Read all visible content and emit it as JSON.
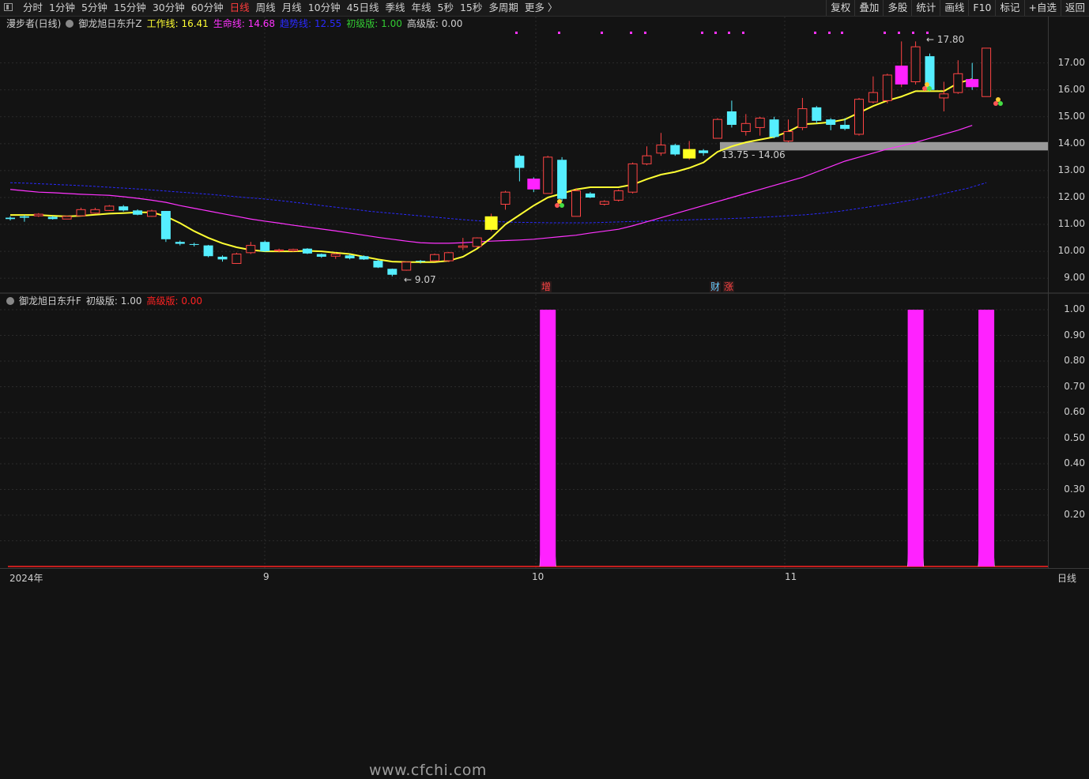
{
  "toolbar": {
    "periods": [
      "分时",
      "1分钟",
      "5分钟",
      "15分钟",
      "30分钟",
      "60分钟",
      "日线",
      "周线",
      "月线",
      "10分钟",
      "45日线",
      "季线",
      "年线",
      "5秒",
      "15秒",
      "多周期",
      "更多 〉"
    ],
    "active_period": "日线",
    "tools": [
      "复权",
      "叠加",
      "多股",
      "统计",
      "画线",
      "F10",
      "标记",
      "+自选",
      "返回"
    ]
  },
  "main": {
    "stock": "漫步者(日线)",
    "indicator": "御龙旭日东升Z",
    "legend": [
      {
        "label": "工作线: 16.41",
        "color": "#ffff33"
      },
      {
        "label": "生命线: 14.68",
        "color": "#ff33ff"
      },
      {
        "label": "趋势线: 12.55",
        "color": "#2a2aff"
      },
      {
        "label": "初级版: 1.00",
        "color": "#33cc33"
      },
      {
        "label": "高级版: 0.00",
        "color": "#d0d0d0"
      }
    ],
    "y_ticks": [
      "17.00",
      "16.00",
      "15.00",
      "14.00",
      "13.00",
      "12.00",
      "11.00",
      "10.00",
      "9.00"
    ],
    "high_label": "17.80",
    "low_label": "9.07",
    "range_label": "13.75 - 14.06",
    "markers": [
      {
        "text": "增",
        "color": "#ff4444"
      },
      {
        "text": "财",
        "color": "#66ccff"
      },
      {
        "text": "涨",
        "color": "#ff4444"
      }
    ]
  },
  "sub": {
    "indicator": "御龙旭日东升F",
    "legend": [
      {
        "label": "初级版: 1.00",
        "color": "#d0d0d0"
      },
      {
        "label": "高级版: 0.00",
        "color": "#ff2222"
      }
    ],
    "y_ticks": [
      "1.00",
      "0.90",
      "0.80",
      "0.70",
      "0.60",
      "0.50",
      "0.40",
      "0.30",
      "0.20"
    ],
    "watermark": "www.cfchi.com"
  },
  "x_axis": {
    "labels": [
      "2024年",
      "9",
      "10",
      "11"
    ],
    "period_label": "日线"
  },
  "colors": {
    "up": "#ff4444",
    "down": "#55eeff",
    "work_line": "#ffff33",
    "life_line": "#ff33ff",
    "trend_line": "#2a2aff",
    "signal_bar": "#ff22ff"
  },
  "chart_data": {
    "type": "candlestick",
    "y_range": [
      8.8,
      17.9
    ],
    "candles": [
      {
        "o": 11.25,
        "c": 11.2,
        "h": 11.3,
        "l": 11.15
      },
      {
        "o": 11.3,
        "c": 11.25,
        "h": 11.35,
        "l": 11.1
      },
      {
        "o": 11.32,
        "c": 11.38,
        "h": 11.42,
        "l": 11.28
      },
      {
        "o": 11.28,
        "c": 11.2,
        "h": 11.32,
        "l": 11.18
      },
      {
        "o": 11.2,
        "c": 11.3,
        "h": 11.33,
        "l": 11.2
      },
      {
        "o": 11.32,
        "c": 11.55,
        "h": 11.62,
        "l": 11.3
      },
      {
        "o": 11.42,
        "c": 11.55,
        "h": 11.62,
        "l": 11.4
      },
      {
        "o": 11.52,
        "c": 11.68,
        "h": 11.72,
        "l": 11.5
      },
      {
        "o": 11.67,
        "c": 11.52,
        "h": 11.72,
        "l": 11.48
      },
      {
        "o": 11.52,
        "c": 11.36,
        "h": 11.56,
        "l": 11.34
      },
      {
        "o": 11.3,
        "c": 11.5,
        "h": 11.55,
        "l": 11.28
      },
      {
        "o": 11.5,
        "c": 10.45,
        "h": 11.5,
        "l": 10.35
      },
      {
        "o": 10.35,
        "c": 10.28,
        "h": 10.4,
        "l": 10.22
      },
      {
        "o": 10.27,
        "c": 10.25,
        "h": 10.32,
        "l": 10.18
      },
      {
        "o": 10.22,
        "c": 9.82,
        "h": 10.24,
        "l": 9.78
      },
      {
        "o": 9.8,
        "c": 9.7,
        "h": 9.85,
        "l": 9.62
      },
      {
        "o": 9.55,
        "c": 9.9,
        "h": 9.95,
        "l": 9.55
      },
      {
        "o": 9.95,
        "c": 10.22,
        "h": 10.35,
        "l": 9.9
      },
      {
        "o": 10.35,
        "c": 10.0,
        "h": 10.4,
        "l": 9.98
      },
      {
        "o": 10.02,
        "c": 10.05,
        "h": 10.1,
        "l": 9.96
      },
      {
        "o": 10.02,
        "c": 10.07,
        "h": 10.1,
        "l": 9.98
      },
      {
        "o": 10.1,
        "c": 9.92,
        "h": 10.12,
        "l": 9.9
      },
      {
        "o": 9.9,
        "c": 9.8,
        "h": 9.92,
        "l": 9.76
      },
      {
        "o": 9.82,
        "c": 9.9,
        "h": 9.95,
        "l": 9.72
      },
      {
        "o": 9.85,
        "c": 9.74,
        "h": 9.9,
        "l": 9.7
      },
      {
        "o": 9.82,
        "c": 9.7,
        "h": 9.85,
        "l": 9.68
      },
      {
        "o": 9.65,
        "c": 9.4,
        "h": 9.68,
        "l": 9.38
      },
      {
        "o": 9.35,
        "c": 9.13,
        "h": 9.36,
        "l": 9.07
      },
      {
        "o": 9.3,
        "c": 9.6,
        "h": 9.62,
        "l": 9.28
      },
      {
        "o": 9.65,
        "c": 9.62,
        "h": 9.68,
        "l": 9.55
      },
      {
        "o": 9.65,
        "c": 9.88,
        "h": 9.92,
        "l": 9.62
      },
      {
        "o": 9.65,
        "c": 9.95,
        "h": 9.98,
        "l": 9.6
      },
      {
        "o": 10.15,
        "c": 10.2,
        "h": 10.5,
        "l": 10.05
      },
      {
        "o": 10.18,
        "c": 10.5,
        "h": 10.52,
        "l": 10.15
      },
      {
        "o": 10.8,
        "c": 11.3,
        "h": 11.4,
        "l": 10.75
      },
      {
        "o": 11.75,
        "c": 12.2,
        "h": 12.25,
        "l": 11.55
      },
      {
        "o": 13.55,
        "c": 13.1,
        "h": 13.6,
        "l": 12.6
      },
      {
        "o": 12.7,
        "c": 12.3,
        "h": 12.75,
        "l": 12.2
      },
      {
        "o": 12.15,
        "c": 13.5,
        "h": 13.55,
        "l": 12.15
      },
      {
        "o": 13.4,
        "c": 11.95,
        "h": 13.5,
        "l": 11.85
      },
      {
        "o": 11.3,
        "c": 12.25,
        "h": 12.35,
        "l": 11.3
      },
      {
        "o": 12.15,
        "c": 12.0,
        "h": 12.2,
        "l": 11.98
      },
      {
        "o": 11.75,
        "c": 11.85,
        "h": 11.9,
        "l": 11.7
      },
      {
        "o": 11.9,
        "c": 12.25,
        "h": 12.3,
        "l": 11.85
      },
      {
        "o": 12.2,
        "c": 13.25,
        "h": 13.3,
        "l": 12.15
      },
      {
        "o": 13.25,
        "c": 13.55,
        "h": 13.9,
        "l": 13.2
      },
      {
        "o": 13.65,
        "c": 13.95,
        "h": 14.4,
        "l": 13.55
      },
      {
        "o": 13.95,
        "c": 13.6,
        "h": 14.0,
        "l": 13.55
      },
      {
        "o": 13.45,
        "c": 13.8,
        "h": 14.1,
        "l": 13.4
      },
      {
        "o": 13.75,
        "c": 13.65,
        "h": 13.8,
        "l": 13.55
      },
      {
        "o": 14.2,
        "c": 14.9,
        "h": 14.95,
        "l": 14.2
      },
      {
        "o": 15.2,
        "c": 14.7,
        "h": 15.6,
        "l": 14.6
      },
      {
        "o": 14.45,
        "c": 14.75,
        "h": 15.1,
        "l": 14.3
      },
      {
        "o": 14.6,
        "c": 14.95,
        "h": 15.0,
        "l": 14.3
      },
      {
        "o": 14.9,
        "c": 14.25,
        "h": 15.0,
        "l": 14.2
      },
      {
        "o": 14.1,
        "c": 14.45,
        "h": 14.9,
        "l": 14.05
      },
      {
        "o": 14.6,
        "c": 15.3,
        "h": 15.7,
        "l": 14.5
      },
      {
        "o": 15.35,
        "c": 14.85,
        "h": 15.4,
        "l": 14.75
      },
      {
        "o": 14.9,
        "c": 14.7,
        "h": 14.95,
        "l": 14.5
      },
      {
        "o": 14.7,
        "c": 14.55,
        "h": 14.95,
        "l": 14.5
      },
      {
        "o": 14.35,
        "c": 15.65,
        "h": 15.7,
        "l": 14.3
      },
      {
        "o": 15.55,
        "c": 15.9,
        "h": 16.5,
        "l": 15.5
      },
      {
        "o": 15.6,
        "c": 16.55,
        "h": 16.6,
        "l": 15.5
      },
      {
        "o": 16.2,
        "c": 16.9,
        "h": 17.8,
        "l": 16.1
      },
      {
        "o": 16.3,
        "c": 17.6,
        "h": 17.8,
        "l": 16.2
      },
      {
        "o": 17.25,
        "c": 16.0,
        "h": 17.35,
        "l": 15.95
      },
      {
        "o": 15.7,
        "c": 15.85,
        "h": 16.3,
        "l": 15.2
      },
      {
        "o": 15.9,
        "c": 16.6,
        "h": 17.1,
        "l": 15.85
      },
      {
        "o": 16.4,
        "c": 16.1,
        "h": 17.0,
        "l": 16.0
      },
      {
        "o": 15.75,
        "c": 17.55,
        "h": 17.55,
        "l": 15.75
      }
    ],
    "work_line": [
      11.35,
      11.35,
      11.35,
      11.32,
      11.3,
      11.32,
      11.36,
      11.4,
      11.42,
      11.45,
      11.45,
      11.3,
      11.05,
      10.75,
      10.5,
      10.3,
      10.15,
      10.05,
      10.0,
      10.0,
      10.0,
      10.02,
      10.0,
      9.95,
      9.9,
      9.8,
      9.7,
      9.62,
      9.6,
      9.6,
      9.6,
      9.65,
      9.8,
      10.1,
      10.5,
      11.0,
      11.35,
      11.7,
      12.0,
      12.15,
      12.3,
      12.38,
      12.38,
      12.38,
      12.48,
      12.68,
      12.85,
      12.95,
      13.1,
      13.3,
      13.7,
      13.9,
      14.05,
      14.15,
      14.25,
      14.45,
      14.72,
      14.75,
      14.8,
      14.9,
      15.15,
      15.4,
      15.6,
      15.75,
      15.95,
      15.95,
      15.95,
      16.25,
      16.4
    ],
    "life_line": [
      12.3,
      12.25,
      12.2,
      12.18,
      12.15,
      12.12,
      12.1,
      12.08,
      12.03,
      11.97,
      11.9,
      11.82,
      11.7,
      11.6,
      11.5,
      11.4,
      11.3,
      11.2,
      11.12,
      11.05,
      10.97,
      10.9,
      10.83,
      10.76,
      10.68,
      10.6,
      10.52,
      10.45,
      10.38,
      10.32,
      10.3,
      10.3,
      10.32,
      10.35,
      10.38,
      10.4,
      10.42,
      10.45,
      10.5,
      10.55,
      10.6,
      10.68,
      10.75,
      10.82,
      10.95,
      11.1,
      11.25,
      11.4,
      11.55,
      11.7,
      11.85,
      12.0,
      12.15,
      12.3,
      12.45,
      12.6,
      12.75,
      12.95,
      13.15,
      13.35,
      13.5,
      13.65,
      13.8,
      13.92,
      14.05,
      14.2,
      14.35,
      14.5,
      14.68
    ],
    "trend_line": [
      12.55,
      12.53,
      12.5,
      12.47,
      12.44,
      12.4,
      12.36,
      12.32,
      12.27,
      12.22,
      12.17,
      12.12,
      12.06,
      12.0,
      11.95,
      11.88,
      11.8,
      11.72,
      11.64,
      11.56,
      11.48,
      11.42,
      11.36,
      11.3,
      11.24,
      11.18,
      11.13,
      11.1,
      11.08,
      11.07,
      11.06,
      11.06,
      11.06,
      11.08,
      11.1,
      11.12,
      11.14,
      11.16,
      11.18,
      11.2,
      11.22,
      11.25,
      11.28,
      11.32,
      11.36,
      11.42,
      11.5,
      11.6,
      11.7,
      11.8,
      11.92,
      12.05,
      12.2,
      12.35,
      12.55
    ],
    "sub_panel": {
      "type": "bar",
      "signals": [
        0,
        0,
        0,
        0,
        0,
        0,
        0,
        0,
        0,
        0,
        0,
        0,
        0,
        0,
        0,
        0,
        0,
        0,
        0,
        0,
        0,
        0,
        0,
        0,
        0,
        0,
        0,
        0,
        0,
        0,
        0,
        0,
        0,
        0,
        0,
        0,
        0,
        0,
        1,
        0,
        0,
        0,
        0,
        0,
        0,
        0,
        0,
        0,
        0,
        0,
        0,
        0,
        0,
        0,
        0,
        0,
        0,
        0,
        0,
        0,
        0,
        0,
        0,
        0,
        1,
        0,
        0,
        0,
        0,
        1
      ],
      "y_range": [
        0,
        1.0
      ]
    }
  }
}
